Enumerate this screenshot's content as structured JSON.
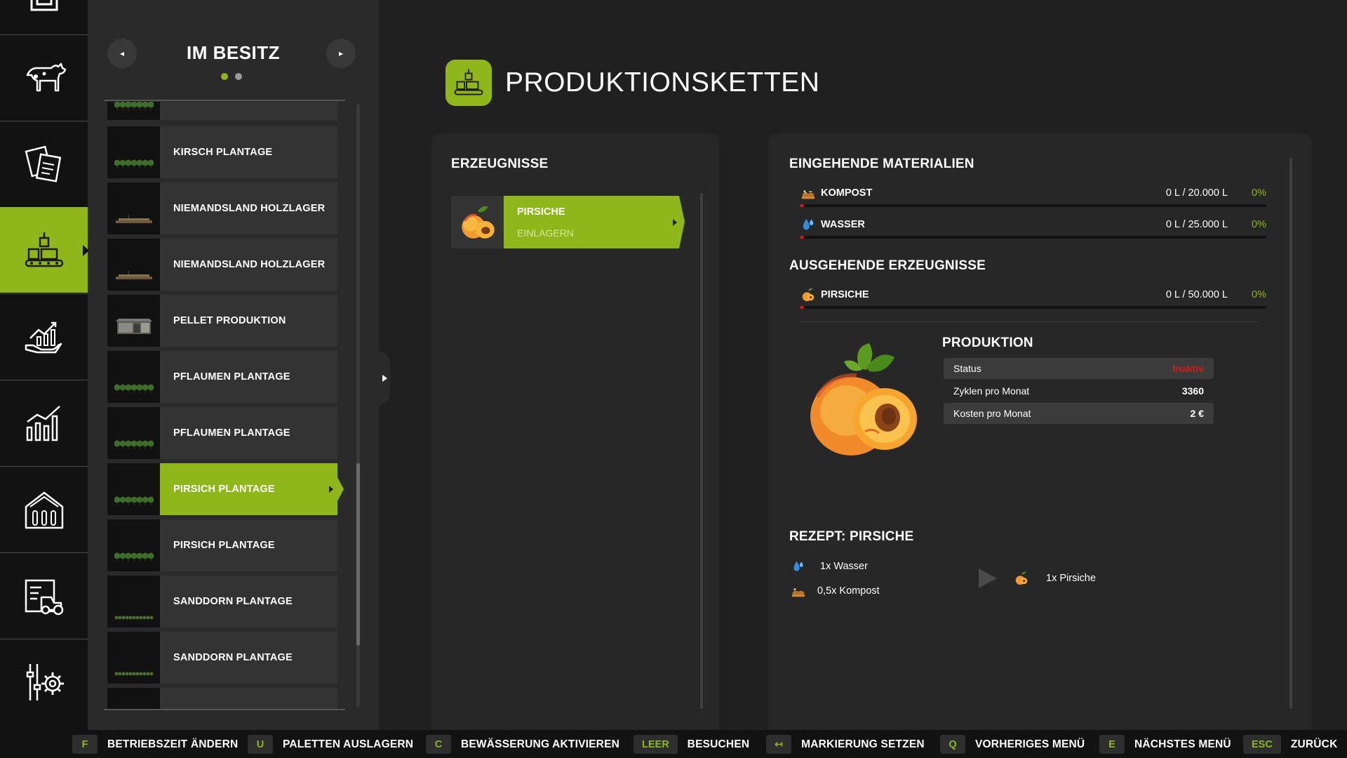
{
  "colors": {
    "accent": "#8fb71a",
    "status_inactive": "#d21b1b",
    "fill_level": "#d01818"
  },
  "sidebar": {
    "items": [
      {
        "icon": "top-cropped-icon",
        "active": false
      },
      {
        "icon": "cow-icon",
        "active": false
      },
      {
        "icon": "contracts-icon",
        "active": false
      },
      {
        "icon": "production-icon",
        "active": true
      },
      {
        "icon": "finance-hand-icon",
        "active": false
      },
      {
        "icon": "statistics-icon",
        "active": false
      },
      {
        "icon": "animal-barn-icon",
        "active": false
      },
      {
        "icon": "vehicle-shop-icon",
        "active": false
      },
      {
        "icon": "settings-icon",
        "active": false
      }
    ]
  },
  "list_panel": {
    "title": "IM BESITZ",
    "prev_label": "◂",
    "next_label": "▸",
    "page_count": 2,
    "active_page": 1,
    "items": [
      {
        "label": "",
        "thumb": "trees",
        "active": false
      },
      {
        "label": "KIRSCH PLANTAGE",
        "thumb": "trees",
        "active": false
      },
      {
        "label": "NIEMANDSLAND HOLZLAGER",
        "thumb": "logs",
        "active": false
      },
      {
        "label": "NIEMANDSLAND HOLZLAGER",
        "thumb": "logs",
        "active": false
      },
      {
        "label": "PELLET PRODUKTION",
        "thumb": "building",
        "active": false
      },
      {
        "label": "PFLAUMEN PLANTAGE",
        "thumb": "trees",
        "active": false
      },
      {
        "label": "PFLAUMEN PLANTAGE",
        "thumb": "trees",
        "active": false
      },
      {
        "label": "PIRSICH PLANTAGE",
        "thumb": "trees",
        "active": true
      },
      {
        "label": "PIRSICH PLANTAGE",
        "thumb": "trees",
        "active": false
      },
      {
        "label": "SANDDORN PLANTAGE",
        "thumb": "shrubs",
        "active": false
      },
      {
        "label": "SANDDORN PLANTAGE",
        "thumb": "shrubs",
        "active": false
      },
      {
        "label": "",
        "thumb": "empty",
        "active": false
      }
    ]
  },
  "header": {
    "title": "PRODUKTIONSKETTEN",
    "icon": "production-icon"
  },
  "products": {
    "heading": "ERZEUGNISSE",
    "items": [
      {
        "name": "PIRSICHE",
        "sub": "EINLAGERN",
        "icon": "peach-icon"
      }
    ]
  },
  "details": {
    "incoming_heading": "EINGEHENDE MATERIALIEN",
    "incoming": [
      {
        "icon": "compost-icon",
        "name": "KOMPOST",
        "amount": "0 L / 20.000 L",
        "percent": "0%",
        "fill": 0.0
      },
      {
        "icon": "water-drop-icon",
        "name": "WASSER",
        "amount": "0 L / 25.000 L",
        "percent": "0%",
        "fill": 0.0
      }
    ],
    "outgoing_heading": "AUSGEHENDE ERZEUGNISSE",
    "outgoing": [
      {
        "icon": "peach-icon",
        "name": "PIRSICHE",
        "amount": "0 L / 50.000 L",
        "percent": "0%",
        "fill": 0.0
      }
    ],
    "production": {
      "heading": "PRODUKTION",
      "rows": [
        {
          "label": "Status",
          "value": "Inaktiv"
        },
        {
          "label": "Zyklen pro Monat",
          "value": "3360"
        },
        {
          "label": "Kosten pro Monat",
          "value": "2 €"
        }
      ]
    },
    "recipe": {
      "heading": "REZEPT: PIRSICHE",
      "inputs": [
        {
          "icon": "water-drop-icon",
          "text": "1x Wasser"
        },
        {
          "icon": "compost-icon",
          "text": "0,5x Kompost"
        }
      ],
      "output": {
        "icon": "peach-icon",
        "text": "1x Pirsiche"
      }
    }
  },
  "bottom_bar": {
    "hints": [
      {
        "key": "F",
        "label": "BETRIEBSZEIT ÄNDERN"
      },
      {
        "key": "U",
        "label": "PALETTEN AUSLAGERN"
      },
      {
        "key": "C",
        "label": "BEWÄSSERUNG AKTIVIEREN"
      },
      {
        "key": "LEER",
        "label": "BESUCHEN"
      },
      {
        "key": "↤",
        "label": "MARKIERUNG SETZEN"
      },
      {
        "key": "Q",
        "label": "VORHERIGES MENÜ"
      },
      {
        "key": "E",
        "label": "NÄCHSTES MENÜ"
      },
      {
        "key": "ESC",
        "label": "ZURÜCK"
      }
    ]
  }
}
